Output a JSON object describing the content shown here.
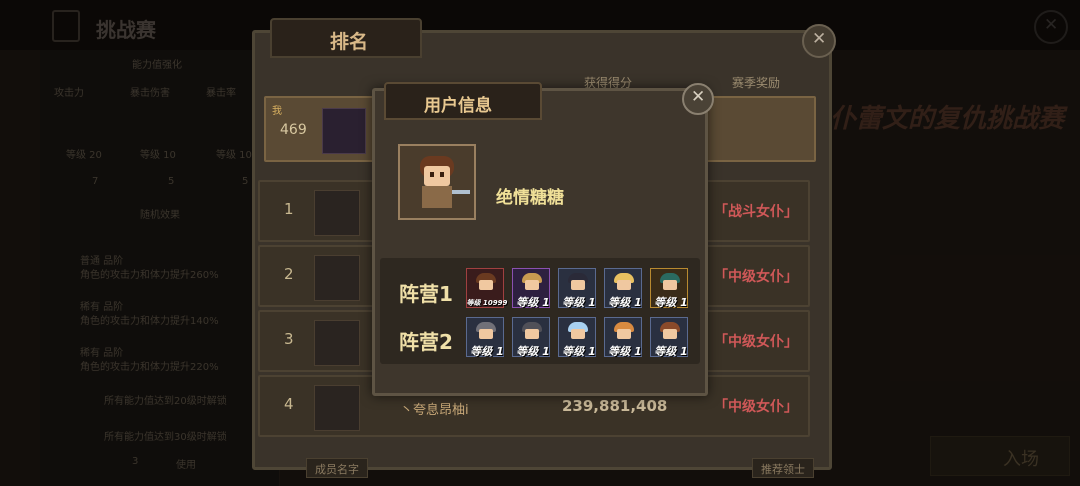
{
  "background": {
    "title": "挑战赛",
    "right_title": "仆蕾文的复仇挑战赛",
    "enter_label": "入场",
    "left": {
      "section1": "能力值强化",
      "stats": [
        "攻击力",
        "暴击伤害",
        "暴击率"
      ],
      "levels": [
        "等级 20",
        "等级 10",
        "等级 10"
      ],
      "counts": [
        "7",
        "5",
        "5"
      ],
      "section2": "随机效果",
      "effects": [
        "普通 品阶",
        "稀有 品阶",
        "稀有 品阶"
      ],
      "effect_desc": [
        "角色的攻击力和体力提升260%",
        "角色的攻击力和体力提升140%",
        "角色的攻击力和体力提升220%"
      ],
      "locked": [
        "所有能力值达到20级时解锁",
        "所有能力值达到30级时解锁"
      ],
      "use_count": "3",
      "use_label": "使用"
    }
  },
  "ranking": {
    "tab": "排名",
    "headers": {
      "score": "获得得分",
      "reward": "赛季奖励"
    },
    "my": {
      "label": "我",
      "rank": "469"
    },
    "rows": [
      {
        "rank": "1",
        "name": "",
        "score": "",
        "reward": "「战斗女仆」"
      },
      {
        "rank": "2",
        "name": "",
        "score": "",
        "reward": "「中级女仆」"
      },
      {
        "rank": "3",
        "name": "",
        "score": "",
        "reward": "「中级女仆」"
      },
      {
        "rank": "4",
        "name": "丶夸息昂柚i",
        "score": "239,881,408",
        "reward": "「中级女仆」"
      }
    ],
    "bottom_left": "成员名字",
    "bottom_right": "推荐领士"
  },
  "user_info": {
    "tab": "用户信息",
    "name": "绝情糖糖",
    "team1_label": "阵营1",
    "team2_label": "阵营2",
    "team1": [
      {
        "level": "等级 10999",
        "frame": "red",
        "hair": "#6a3a20"
      },
      {
        "level": "等级 1",
        "frame": "purple",
        "hair": "#c89a50"
      },
      {
        "level": "等级 1",
        "frame": "gray",
        "hair": "#2a2a38"
      },
      {
        "level": "等级 1",
        "frame": "gray",
        "hair": "#e8c060"
      },
      {
        "level": "等级 1",
        "frame": "gold",
        "hair": "#2a6a60"
      }
    ],
    "team2": [
      {
        "level": "等级 1",
        "frame": "gray",
        "hair": "#707078"
      },
      {
        "level": "等级 1",
        "frame": "gray",
        "hair": "#505058"
      },
      {
        "level": "等级 1",
        "frame": "gray",
        "hair": "#a8d0f0"
      },
      {
        "level": "等级 1",
        "frame": "gray",
        "hair": "#d88a40"
      },
      {
        "level": "等级 1",
        "frame": "gray",
        "hair": "#8a4a2a"
      }
    ]
  },
  "colors": {
    "reward_red": "#d05858",
    "name_yellow": "#f0e098"
  }
}
